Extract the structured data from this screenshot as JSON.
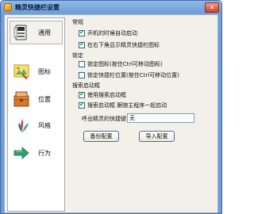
{
  "window": {
    "title": "精灵快捷栏设置",
    "close_label": "✕"
  },
  "sidebar": {
    "items": [
      {
        "label": "通用",
        "icon": "general-icon",
        "selected": true
      },
      {
        "label": "图标",
        "icon": "icon-settings-icon"
      },
      {
        "label": "位置",
        "icon": "position-icon"
      },
      {
        "label": "风格",
        "icon": "style-icon"
      },
      {
        "label": "行为",
        "icon": "behavior-icon"
      }
    ]
  },
  "general": {
    "section_label": "常规",
    "options": [
      {
        "label": "开机的时候自动启动",
        "checked": true
      },
      {
        "label": "在右下角显示精灵快捷栏图标",
        "checked": true
      }
    ]
  },
  "lock": {
    "section_label": "锁定",
    "options": [
      {
        "label": "锁定图标(按住Ctrl可移动图标)",
        "checked": false
      },
      {
        "label": "锁定快捷栏位置(按住Ctrl可移动位置)",
        "checked": false
      }
    ]
  },
  "search": {
    "section_label": "搜索启动框",
    "options": [
      {
        "label": "使用搜索启动框",
        "checked": true
      },
      {
        "label": "搜索启动框 跟随主程序一起启动",
        "checked": true
      }
    ]
  },
  "hotkey": {
    "label": "呼出精灵的快捷键：",
    "value": "无"
  },
  "buttons": {
    "backup": "备份配置",
    "import": "导入配置"
  },
  "colors": {
    "titlebar": "#6d9cd6",
    "client_bg": "#f2f0e8",
    "check": "#17a317"
  }
}
